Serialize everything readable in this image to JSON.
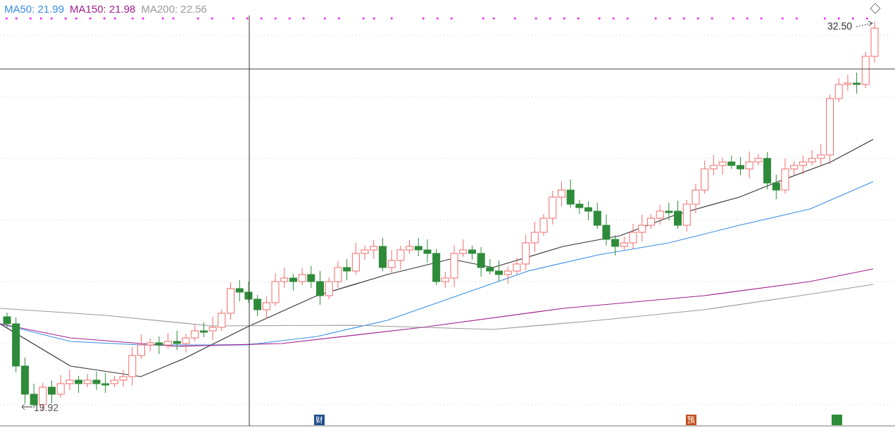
{
  "legend": [
    {
      "label": "MA50: 21.99",
      "color": "#3a8ee6"
    },
    {
      "label": "MA150: 21.98",
      "color": "#a0208e"
    },
    {
      "label": "MA200: 22.56",
      "color": "#9a9a9a"
    }
  ],
  "price_labels": [
    {
      "kind": "high",
      "text": "32.50"
    },
    {
      "kind": "low",
      "text": "19.92"
    }
  ],
  "event_markers": [
    {
      "text": "财",
      "color": "#1f4e8c"
    },
    {
      "text": "预",
      "color": "#c0501a"
    },
    {
      "color": "#2e8b3a"
    }
  ]
}
